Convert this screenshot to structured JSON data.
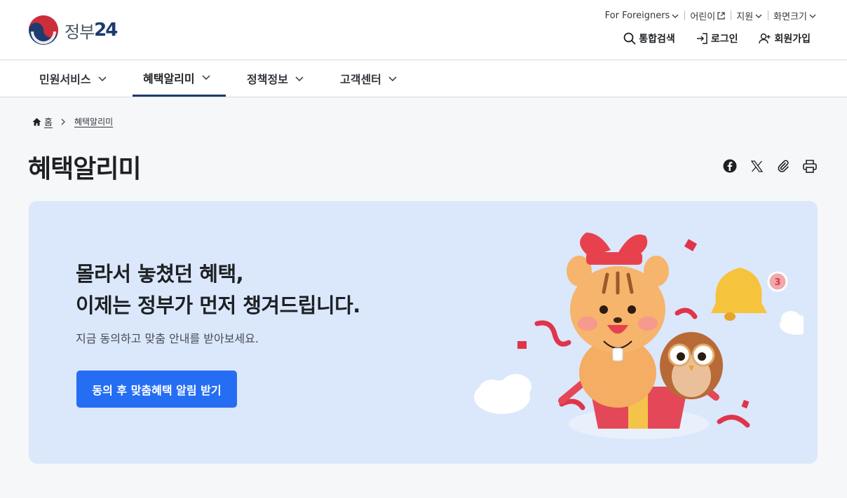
{
  "header": {
    "logo_text": "정부",
    "logo_num": "24",
    "utility": [
      {
        "label": "For Foreigners",
        "icon": "chevron-down-icon"
      },
      {
        "label": "어린이",
        "icon": "external-link-icon"
      },
      {
        "label": "지원",
        "icon": "chevron-down-icon"
      },
      {
        "label": "화면크기",
        "icon": "chevron-down-icon"
      }
    ],
    "actions": [
      {
        "label": "통합검색",
        "icon": "search-icon"
      },
      {
        "label": "로그인",
        "icon": "login-icon"
      },
      {
        "label": "회원가입",
        "icon": "user-add-icon"
      }
    ]
  },
  "gnb": {
    "items": [
      {
        "label": "민원서비스"
      },
      {
        "label": "혜택알리미"
      },
      {
        "label": "정책정보"
      },
      {
        "label": "고객센터"
      }
    ],
    "active": "혜택알리미"
  },
  "breadcrumb": {
    "home": "홈",
    "current": "혜택알리미"
  },
  "page": {
    "title": "혜택알리미"
  },
  "share": [
    "facebook-icon",
    "x-icon",
    "link-icon",
    "print-icon"
  ],
  "banner": {
    "headline_line1": "몰라서 놓쳤던 혜택,",
    "headline_line2": "이제는 정부가 먼저 챙겨드립니다.",
    "subtext": "지금 동의하고 맞춤 안내를 받아보세요.",
    "cta_label": "동의 후 맞춤혜택 알림 받기",
    "bell_badge": "3"
  },
  "colors": {
    "primary": "#256ef4",
    "navy": "#1e3a6e",
    "banner_bg": "#dbe7fb",
    "page_bg": "#f6f7f9"
  }
}
